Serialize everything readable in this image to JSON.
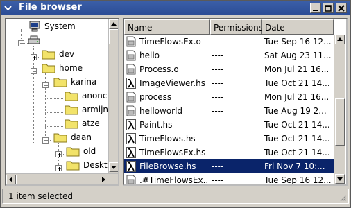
{
  "window": {
    "title": "File browser"
  },
  "tree": {
    "nodes": [
      {
        "label": "System",
        "icon": "computer-icon"
      },
      {
        "label": "",
        "icon": "drive-icon"
      },
      {
        "label": "dev",
        "icon": "folder-icon"
      },
      {
        "label": "home",
        "icon": "folder-icon"
      },
      {
        "label": "karina",
        "icon": "folder-icon"
      },
      {
        "label": "anoncvs",
        "icon": "folder-icon"
      },
      {
        "label": "armijn",
        "icon": "folder-icon"
      },
      {
        "label": "atze",
        "icon": "folder-icon"
      },
      {
        "label": "daan",
        "icon": "folder-icon"
      },
      {
        "label": "old",
        "icon": "folder-icon"
      },
      {
        "label": "Deskt",
        "icon": "folder-icon"
      }
    ]
  },
  "list": {
    "columns": [
      "Name",
      "Permissions",
      "Date"
    ],
    "rows": [
      {
        "name": "TimeFlowsEx.o",
        "perm": "----",
        "date": "Tue Sep 16 12...",
        "icon": "file-icon"
      },
      {
        "name": "hello",
        "perm": "----",
        "date": "Sat Aug 23 11...",
        "icon": "file-icon"
      },
      {
        "name": "Process.o",
        "perm": "----",
        "date": "Mon Jul 21 16...",
        "icon": "file-icon"
      },
      {
        "name": "ImageViewer.hs",
        "perm": "----",
        "date": "Tue Oct 21 14...",
        "icon": "lambda-icon"
      },
      {
        "name": "process",
        "perm": "----",
        "date": "Mon Jul 21 16...",
        "icon": "file-icon"
      },
      {
        "name": "helloworld",
        "perm": "----",
        "date": "Tue Aug 19 2...",
        "icon": "file-icon"
      },
      {
        "name": "Paint.hs",
        "perm": "----",
        "date": "Tue Oct 21 14...",
        "icon": "lambda-icon"
      },
      {
        "name": "TimeFlows.hs",
        "perm": "----",
        "date": "Tue Oct 21 14...",
        "icon": "lambda-icon"
      },
      {
        "name": "TimeFlowsEx.hs",
        "perm": "----",
        "date": "Tue Oct 21 14...",
        "icon": "lambda-icon"
      },
      {
        "name": "FileBrowse.hs",
        "perm": "----",
        "date": "Fri Nov  7 10:...",
        "icon": "lambda-icon",
        "selected": true
      },
      {
        "name": ".#TimeFlowsEx...",
        "perm": "----",
        "date": "Tue Sep 16 12...",
        "icon": "file-icon"
      }
    ]
  },
  "status": {
    "text": "1 item selected"
  },
  "colors": {
    "titlebar": "#2b4c95",
    "selection": "#0a246a",
    "folder": "#f2e36a"
  }
}
